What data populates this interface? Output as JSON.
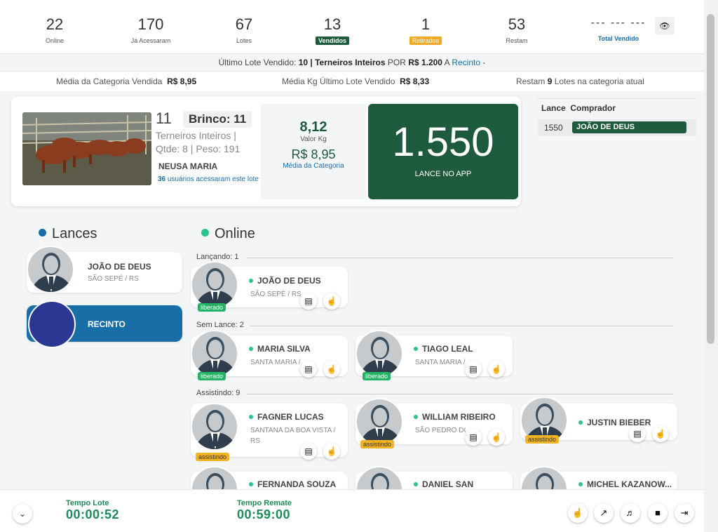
{
  "stats": [
    {
      "value": "22",
      "label": "Online",
      "style": "plain"
    },
    {
      "value": "170",
      "label": "Já Acessaram",
      "style": "plain"
    },
    {
      "value": "67",
      "label": "Lotes",
      "style": "plain"
    },
    {
      "value": "13",
      "label": "Vendidos",
      "style": "green"
    },
    {
      "value": "1",
      "label": "Retirados",
      "style": "orange"
    },
    {
      "value": "53",
      "label": "Restam",
      "style": "plain"
    }
  ],
  "total": {
    "value": "--- --- ---",
    "label": "Total Vendido"
  },
  "last_lot": {
    "prefix": "Último Lote Vendido:",
    "lot": "10 | Terneiros Inteiros",
    "por": "POR",
    "price": "R$ 1.200",
    "a": "A",
    "buyer": "Recinto -"
  },
  "averages": {
    "cat_label": "Média da Categoria Vendida",
    "cat_value": "R$ 8,95",
    "kg_label": "Média Kg Último Lote Vendido",
    "kg_value": "R$ 8,33",
    "rest_prefix": "Restam",
    "rest_count": "9",
    "rest_suffix": "Lotes na categoria atual"
  },
  "lot": {
    "number": "11",
    "brinco": "Brinco: 11",
    "category": "Terneiros Inteiros | Qtde: 8 | Peso: 191",
    "seller": "NEUSA MARIA",
    "users_count": "36",
    "users_text": "usuários acessaram este lote",
    "valor_kg": "8,12",
    "valor_kg_label": "Valor Kg",
    "media": "R$ 8,95",
    "media_label": "Média da Categoria",
    "bid": "1.550",
    "bid_label": "LANCE NO APP"
  },
  "lances_table": {
    "col1": "Lance",
    "col2": "Comprador",
    "rows": [
      {
        "value": "1550",
        "buyer": "JOÃO DE DEUS"
      }
    ]
  },
  "sections": {
    "lances": "Lances",
    "online": "Online"
  },
  "lances": [
    {
      "name": "JOÃO DE DEUS",
      "location": "SÃO SEPÉ / RS"
    },
    {
      "name": "RECINTO",
      "location": ""
    }
  ],
  "groups": {
    "lancando": "Lançando: 1",
    "sem_lance": "Sem Lance: 2",
    "assistindo": "Assistindo: 9"
  },
  "online_users": [
    {
      "name": "JOÃO DE DEUS",
      "location": "SÃO SEPÉ / RS",
      "badge": "liberado"
    },
    {
      "name": "MARIA SILVA",
      "location": "SANTA MARIA /",
      "badge": "liberado"
    },
    {
      "name": "TIAGO LEAL",
      "location": "SANTA MARIA /",
      "badge": "liberado"
    },
    {
      "name": "FAGNER LUCAS",
      "location": "SANTANA DA BOA VISTA / RS",
      "badge": "assistindo"
    },
    {
      "name": "WILLIAM RIBEIRO",
      "location": "SÃO PEDRO DO SUL / RS",
      "badge": "assistindo"
    },
    {
      "name": "JUSTIN BIEBER",
      "location": "",
      "badge": "assistindo"
    },
    {
      "name": "FERNANDA SOUZA",
      "location": "",
      "badge": ""
    },
    {
      "name": "DANIEL SAN",
      "location": "",
      "badge": ""
    },
    {
      "name": "MICHEL KAZANOW...",
      "location": "",
      "badge": ""
    }
  ],
  "footer": {
    "tempo_lote_label": "Tempo Lote",
    "tempo_lote": "00:00:52",
    "tempo_remate_label": "Tempo Remate",
    "tempo_remate": "00:59:00"
  },
  "icons": {
    "eye": "eye-icon",
    "chat": "chat-icon",
    "hand": "hand-icon",
    "chevron": "chevron-down-icon",
    "chart": "chart-icon",
    "volume": "volume-icon",
    "stop": "stop-icon",
    "exit": "exit-icon"
  },
  "colors": {
    "green": "#1e5a3c",
    "blue": "#1a6ea8",
    "orange": "#f0a825",
    "online_dot": "#28c38e"
  }
}
